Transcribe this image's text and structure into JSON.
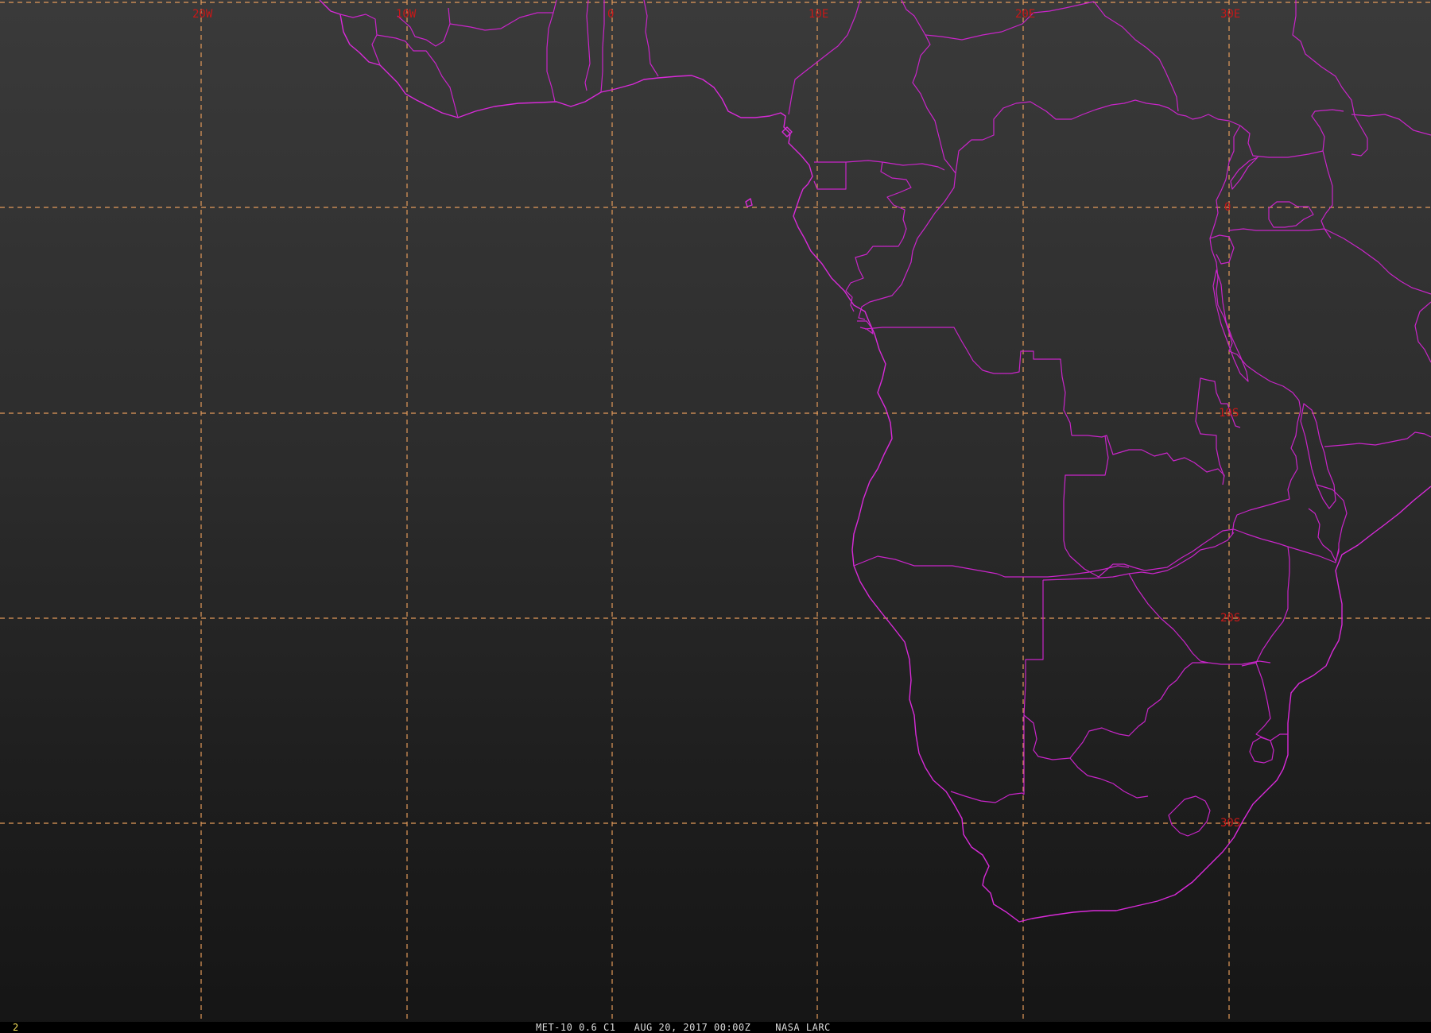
{
  "map": {
    "graticule": {
      "longitude_labels": [
        "20W",
        "10W",
        "0",
        "10E",
        "20E",
        "30E"
      ],
      "latitude_labels": [
        "0",
        "10S",
        "20S",
        "30S"
      ]
    },
    "colors": {
      "background": "#2e2e2e",
      "boundaries": "#d92ad9",
      "grid": "#e39a5a",
      "labels": "#c81818"
    }
  },
  "status_bar": {
    "frame_number": "2",
    "caption": "MET-10 0.6 C1   AUG 20, 2017 00:00Z    NASA LARC"
  }
}
